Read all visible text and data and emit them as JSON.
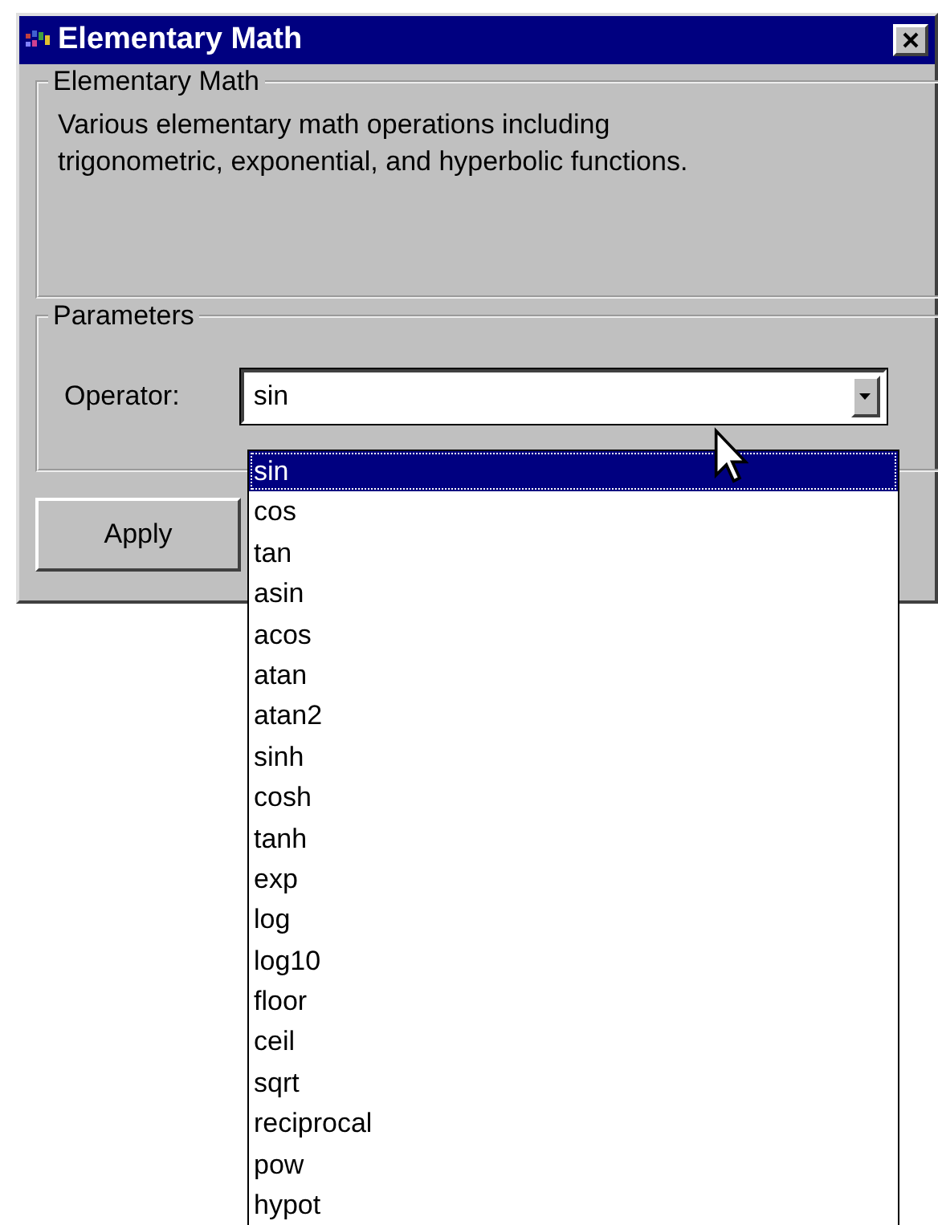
{
  "window": {
    "title": "Elementary Math"
  },
  "description_group": {
    "title": "Elementary Math",
    "text": "Various elementary math operations including trigonometric, exponential, and hyperbolic functions."
  },
  "parameters_group": {
    "title": "Parameters",
    "operator": {
      "label": "Operator:",
      "value": "sin",
      "expanded": true,
      "options": [
        {
          "label": "sin",
          "selected": true
        },
        {
          "label": "cos",
          "selected": false
        },
        {
          "label": "tan",
          "selected": false
        },
        {
          "label": "asin",
          "selected": false
        },
        {
          "label": "acos",
          "selected": false
        },
        {
          "label": "atan",
          "selected": false
        },
        {
          "label": "atan2",
          "selected": false
        },
        {
          "label": "sinh",
          "selected": false
        },
        {
          "label": "cosh",
          "selected": false
        },
        {
          "label": "tanh",
          "selected": false
        },
        {
          "label": "exp",
          "selected": false
        },
        {
          "label": "log",
          "selected": false
        },
        {
          "label": "log10",
          "selected": false
        },
        {
          "label": "floor",
          "selected": false
        },
        {
          "label": "ceil",
          "selected": false
        },
        {
          "label": "sqrt",
          "selected": false
        },
        {
          "label": "reciprocal",
          "selected": false
        },
        {
          "label": "pow",
          "selected": false
        },
        {
          "label": "hypot",
          "selected": false
        }
      ]
    }
  },
  "buttons": [
    "Apply"
  ]
}
